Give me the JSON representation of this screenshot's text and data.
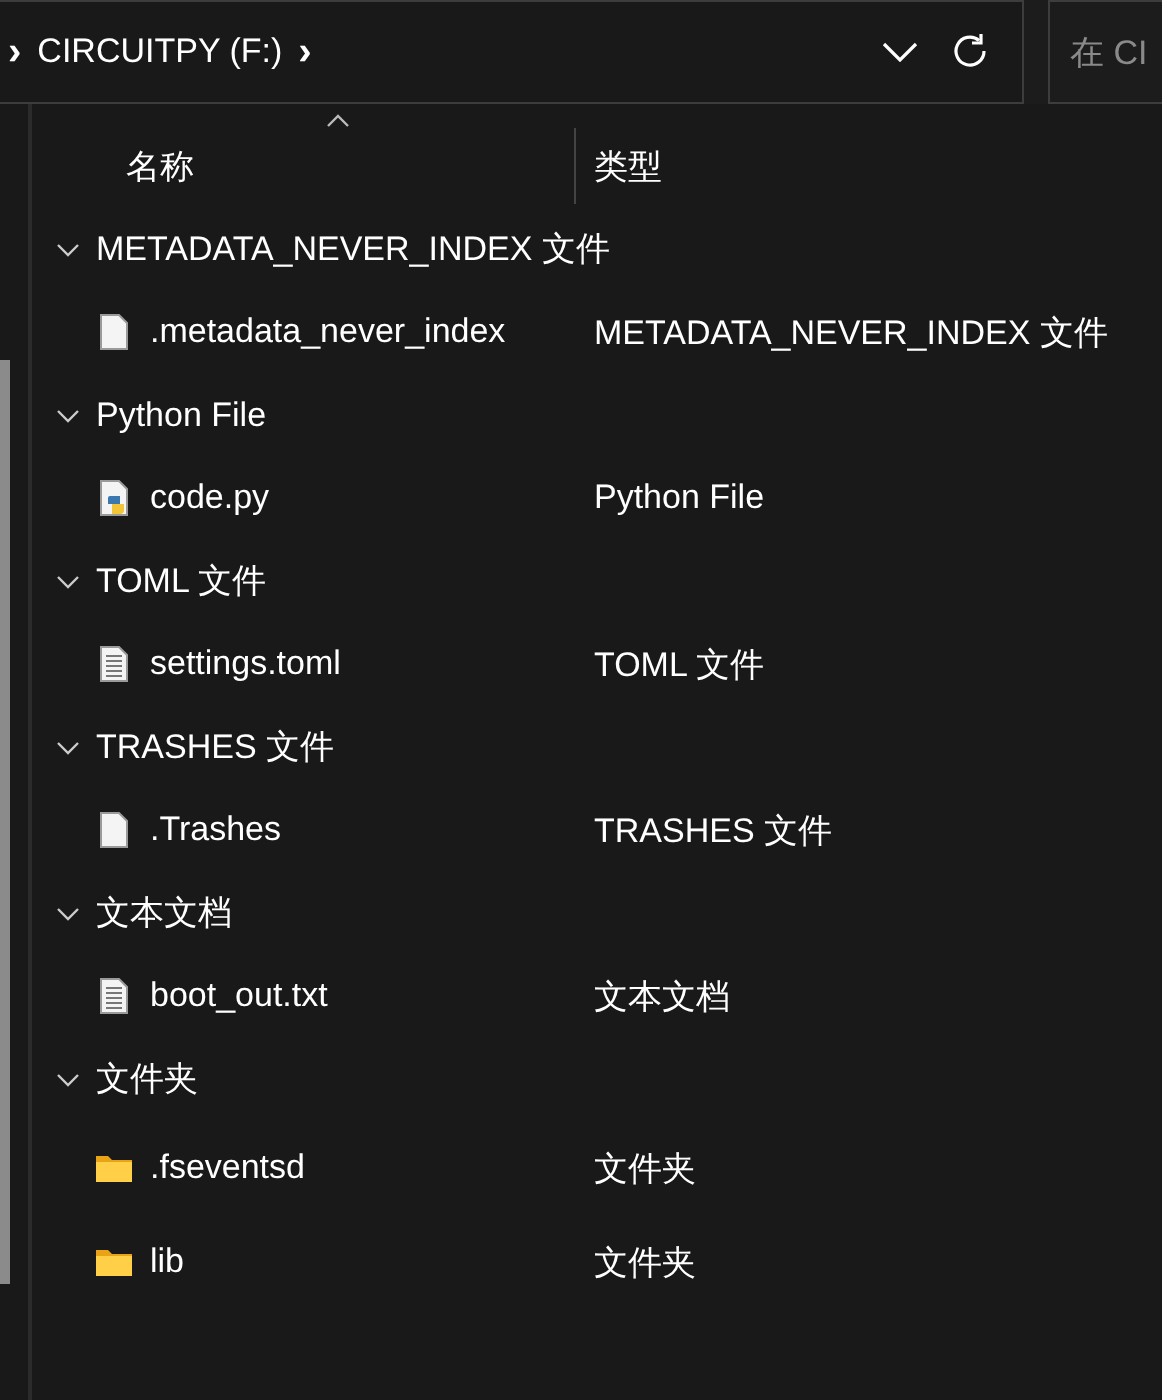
{
  "address_bar": {
    "separator_before": "›",
    "location": "CIRCUITPY (F:)",
    "separator_after": "›"
  },
  "search": {
    "placeholder": "在 CI"
  },
  "columns": [
    {
      "label": "名称",
      "sorted": true
    },
    {
      "label": "类型",
      "sorted": false
    }
  ],
  "groups": [
    {
      "label": "METADATA_NEVER_INDEX 文件",
      "expanded": true,
      "items": [
        {
          "name": ".metadata_never_index",
          "type": "METADATA_NEVER_INDEX 文件",
          "kind": "blank"
        }
      ]
    },
    {
      "label": "Python File",
      "expanded": true,
      "items": [
        {
          "name": "code.py",
          "type": "Python File",
          "kind": "python"
        }
      ]
    },
    {
      "label": "TOML 文件",
      "expanded": true,
      "items": [
        {
          "name": "settings.toml",
          "type": "TOML 文件",
          "kind": "text"
        }
      ]
    },
    {
      "label": "TRASHES 文件",
      "expanded": true,
      "items": [
        {
          "name": ".Trashes",
          "type": "TRASHES 文件",
          "kind": "blank"
        }
      ]
    },
    {
      "label": "文本文档",
      "expanded": true,
      "items": [
        {
          "name": "boot_out.txt",
          "type": "文本文档",
          "kind": "text"
        }
      ]
    },
    {
      "label": "文件夹",
      "expanded": true,
      "items": [
        {
          "name": ".fseventsd",
          "type": "文件夹",
          "kind": "folder"
        },
        {
          "name": "lib",
          "type": "文件夹",
          "kind": "folder"
        }
      ]
    }
  ]
}
